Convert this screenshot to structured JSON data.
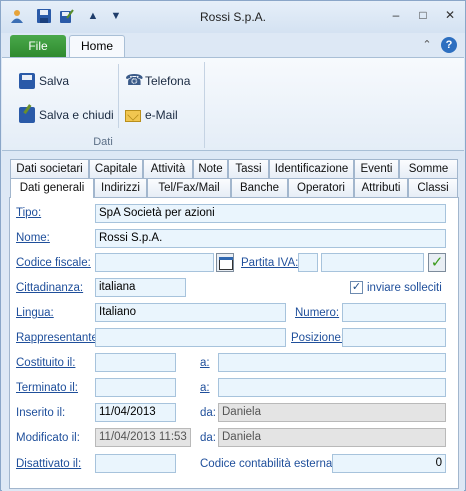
{
  "window": {
    "title": "Rossi S.p.A."
  },
  "quick_access": {
    "icons": [
      "user-icon",
      "save-icon",
      "save-close-icon",
      "arrow-up-icon",
      "arrow-down-icon"
    ]
  },
  "ribbon": {
    "tabs": {
      "file": "File",
      "home": "Home"
    },
    "buttons": {
      "save": "Salva",
      "save_close": "Salva e chiudi",
      "phone": "Telefona",
      "email": "e-Mail"
    },
    "group_label": "Dati"
  },
  "tabs_row1": [
    "Dati societari",
    "Capitale",
    "Attività",
    "Note",
    "Tassi",
    "Identificazione",
    "Eventi",
    "Somme"
  ],
  "tabs_row2": [
    "Dati generali",
    "Indirizzi",
    "Tel/Fax/Mail",
    "Banche",
    "Operatori",
    "Attributi",
    "Classi"
  ],
  "form": {
    "tipo": {
      "label": "Tipo:",
      "value": "SpA Società per azioni"
    },
    "nome": {
      "label": "Nome:",
      "value": "Rossi S.p.A."
    },
    "codice_fiscale": {
      "label": "Codice fiscale:",
      "value": ""
    },
    "partita_iva": {
      "label": "Partita IVA:",
      "prefix": "",
      "value": ""
    },
    "cittadinanza": {
      "label": "Cittadinanza:",
      "value": "italiana"
    },
    "inviare_solleciti": {
      "label": "inviare solleciti",
      "checked": true
    },
    "lingua": {
      "label": "Lingua:",
      "value": "Italiano"
    },
    "numero": {
      "label": "Numero:",
      "value": ""
    },
    "rappresentante": {
      "label": "Rappresentante:",
      "value": ""
    },
    "posizione": {
      "label": "Posizione:",
      "value": ""
    },
    "costituito": {
      "label": "Costituito il:",
      "value": "",
      "a_label": "a:",
      "a_value": ""
    },
    "terminato": {
      "label": "Terminato il:",
      "value": "",
      "a_label": "a:",
      "a_value": ""
    },
    "inserito": {
      "label": "Inserito il:",
      "value": "11/04/2013",
      "da_label": "da:",
      "da_value": "Daniela"
    },
    "modificato": {
      "label": "Modificato il:",
      "value": "11/04/2013 11:53",
      "da_label": "da:",
      "da_value": "Daniela"
    },
    "disattivato": {
      "label": "Disattivato il:",
      "value": ""
    },
    "codice_contabilita": {
      "label": "Codice contabilità esterna:",
      "value": "0"
    }
  }
}
